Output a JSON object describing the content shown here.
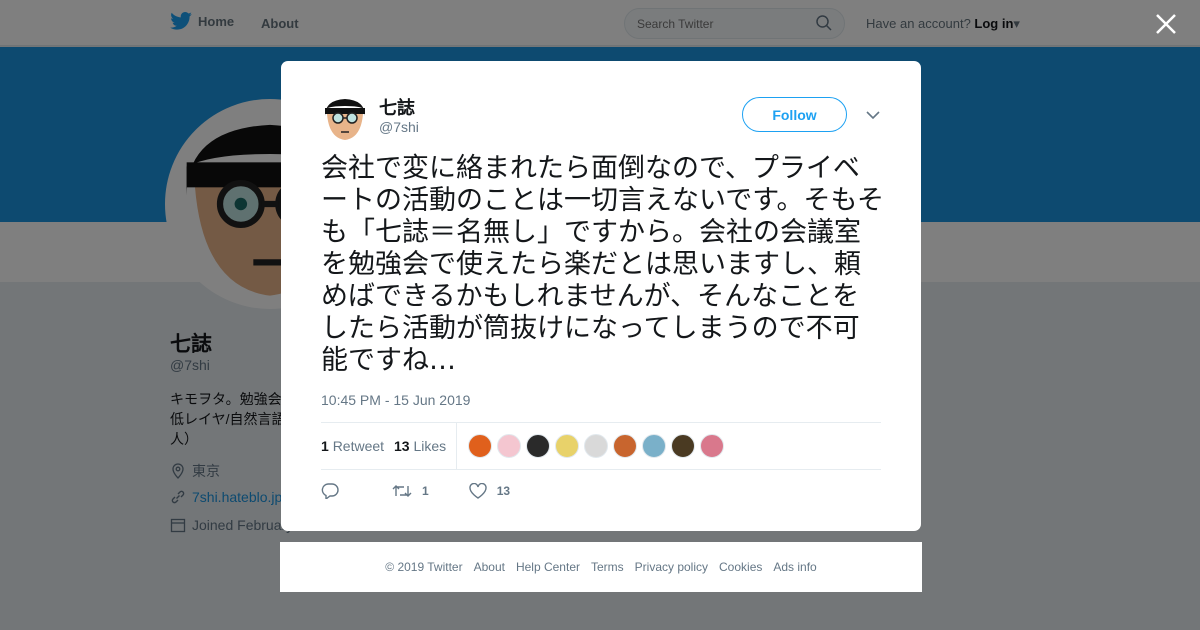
{
  "topbar": {
    "home_label": "Home",
    "about_label": "About",
    "search_placeholder": "Search Twitter",
    "account_prompt": "Have an account?",
    "login_label": "Log in"
  },
  "profile": {
    "name": "七誌",
    "handle": "@7shi",
    "bio": "キモヲタ。勉強会 低レイヤ/自然言語 人）",
    "location": "東京",
    "website": "7shi.hateblo.jp",
    "joined": "Joined February"
  },
  "tweet": {
    "author_name": "七誌",
    "author_handle": "@7shi",
    "follow_label": "Follow",
    "text": "会社で変に絡まれたら面倒なので、プライベートの活動のことは一切言えないです。そもそも「七誌＝名無し」ですから。会社の会議室を勉強会で使えたら楽だとは思いますし、頼めばできるかもしれませんが、そんなことをしたら活動が筒抜けになってしまうので不可能ですね…",
    "timestamp": "10:45 PM - 15 Jun 2019",
    "retweet_count": "1",
    "retweet_label": "Retweet",
    "like_count": "13",
    "like_label": "Likes",
    "action_retweet_count": "1",
    "action_like_count": "13"
  },
  "likers": [
    {
      "color": "#e0601c"
    },
    {
      "color": "#f4c6d0"
    },
    {
      "color": "#2a2a2a"
    },
    {
      "color": "#e8d26a"
    },
    {
      "color": "#d9d9d9"
    },
    {
      "color": "#c8652e"
    },
    {
      "color": "#7ab0c9"
    },
    {
      "color": "#4a3a22"
    },
    {
      "color": "#d9788c"
    }
  ],
  "footer": {
    "copyright": "© 2019 Twitter",
    "about": "About",
    "help": "Help Center",
    "terms": "Terms",
    "privacy": "Privacy policy",
    "cookies": "Cookies",
    "ads": "Ads info"
  },
  "colors": {
    "brand": "#1da1f2",
    "banner": "#1b95e0"
  }
}
